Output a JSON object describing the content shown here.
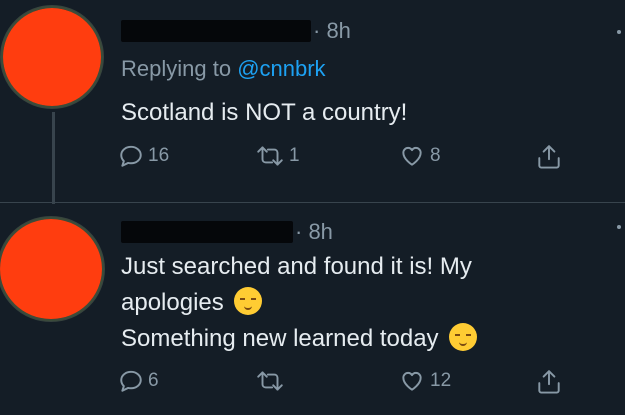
{
  "tweets": [
    {
      "time": "· 8h",
      "replying_label": "Replying to ",
      "replying_handle": "@cnnbrk",
      "text_lines": [
        "Scotland is NOT a country!"
      ],
      "counts": {
        "reply": "16",
        "retweet": "1",
        "like": "8"
      }
    },
    {
      "time": "· 8h",
      "text_lines": [
        "Just searched and found it is! My",
        "apologies",
        "Something new learned today"
      ],
      "counts": {
        "reply": "6",
        "retweet": "",
        "like": "12"
      }
    }
  ],
  "icons": {
    "reply": "reply-icon",
    "retweet": "retweet-icon",
    "like": "heart-icon",
    "share": "share-icon",
    "emoji": "pensive-face-emoji",
    "emoji2": "relieved-face-emoji"
  },
  "colors": {
    "background": "#141d26",
    "text": "#e6ecf0",
    "muted": "#8899a6",
    "link": "#1da1f2",
    "avatar_redaction": "#ff3d0f"
  }
}
